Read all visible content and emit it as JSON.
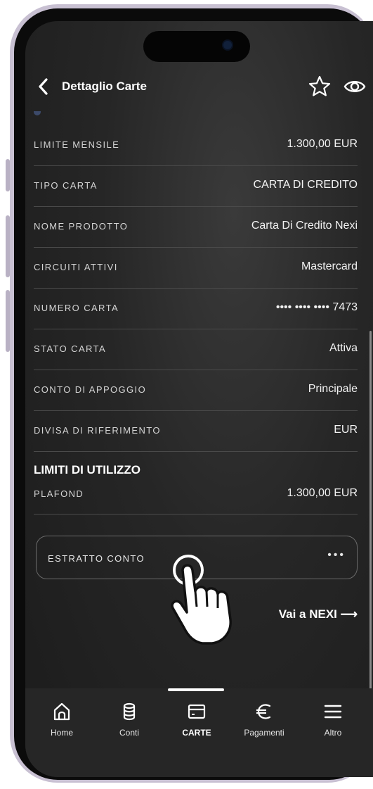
{
  "header": {
    "title": "Dettaglio Carte"
  },
  "details": [
    {
      "label": "LIMITE MENSILE",
      "value": "1.300,00 EUR"
    },
    {
      "label": "TIPO CARTA",
      "value": "CARTA DI CREDITO"
    },
    {
      "label": "NOME PRODOTTO",
      "value": "Carta Di Credito Nexi"
    },
    {
      "label": "CIRCUITI ATTIVI",
      "value": "Mastercard"
    },
    {
      "label": "NUMERO CARTA",
      "value": "•••• •••• •••• 7473"
    },
    {
      "label": "STATO CARTA",
      "value": "Attiva"
    },
    {
      "label": "CONTO DI APPOGGIO",
      "value": "Principale"
    },
    {
      "label": "DIVISA DI RIFERIMENTO",
      "value": "EUR"
    }
  ],
  "limits": {
    "title": "LIMITI DI UTILIZZO",
    "label": "PLAFOND",
    "value": "1.300,00 EUR"
  },
  "estratto": {
    "label": "ESTRATTO CONTO",
    "menu": "•••"
  },
  "nexi_link": "Vai a NEXI ⟶",
  "tabs": [
    {
      "label": "Home",
      "icon": "home-icon"
    },
    {
      "label": "Conti",
      "icon": "database-icon"
    },
    {
      "label": "CARTE",
      "icon": "card-icon"
    },
    {
      "label": "Pagamenti",
      "icon": "euro-icon"
    },
    {
      "label": "Altro",
      "icon": "menu-icon"
    }
  ],
  "active_tab": "CARTE"
}
